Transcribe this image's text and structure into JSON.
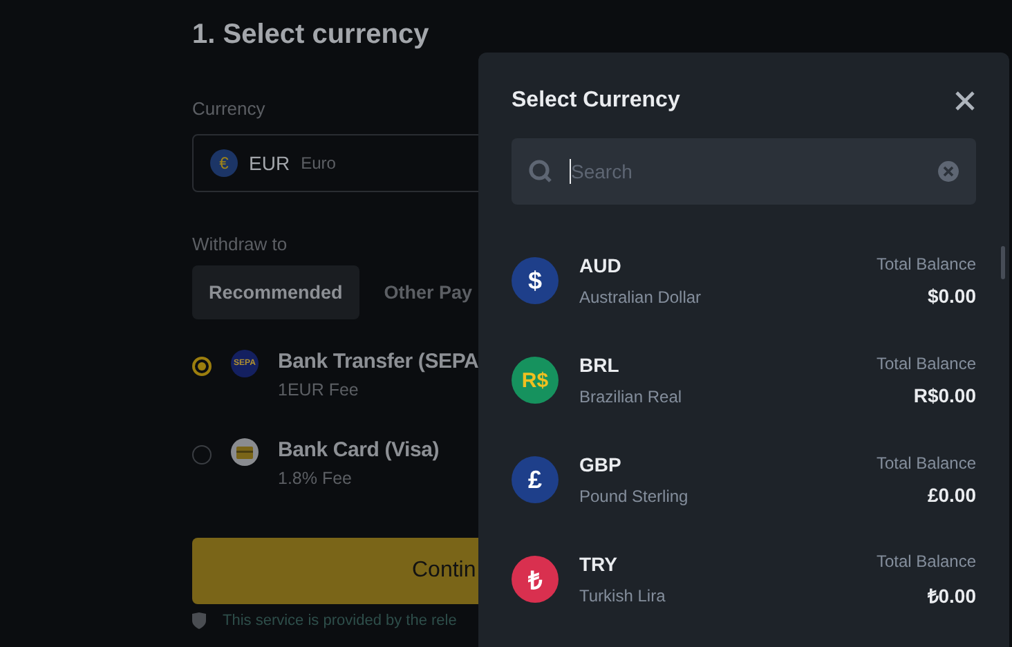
{
  "page": {
    "title": "1. Select currency",
    "currency_label": "Currency",
    "currency_field": {
      "symbol": "€",
      "code": "EUR",
      "name": "Euro"
    },
    "withdraw_label": "Withdraw to",
    "tabs": [
      {
        "label": "Recommended",
        "selected": true
      },
      {
        "label": "Other Pay",
        "selected": false
      }
    ],
    "methods": [
      {
        "badge": "SEPA",
        "kind": "sepa",
        "title": "Bank Transfer (SEPA",
        "fee": "1EUR Fee",
        "selected": true
      },
      {
        "kind": "card",
        "title": "Bank Card (Visa)",
        "fee": "1.8% Fee",
        "selected": false
      }
    ],
    "continue_button": "Contin",
    "footnote": "This service is provided by the rele"
  },
  "modal": {
    "title": "Select Currency",
    "search": {
      "placeholder": "Search"
    },
    "currencies": [
      {
        "symbol": "$",
        "color": "#1e3f8a",
        "code": "AUD",
        "name": "Australian Dollar",
        "balance_label": "Total Balance",
        "balance": "$0.00"
      },
      {
        "symbol": "R$",
        "color": "#16925e",
        "code": "BRL",
        "name": "Brazilian Real",
        "balance_label": "Total Balance",
        "balance": "R$0.00"
      },
      {
        "symbol": "£",
        "color": "#1e3f8a",
        "code": "GBP",
        "name": "Pound Sterling",
        "balance_label": "Total Balance",
        "balance": "£0.00"
      },
      {
        "symbol": "₺",
        "color": "#d9304f",
        "code": "TRY",
        "name": "Turkish Lira",
        "balance_label": "Total Balance",
        "balance": "₺0.00"
      }
    ]
  }
}
